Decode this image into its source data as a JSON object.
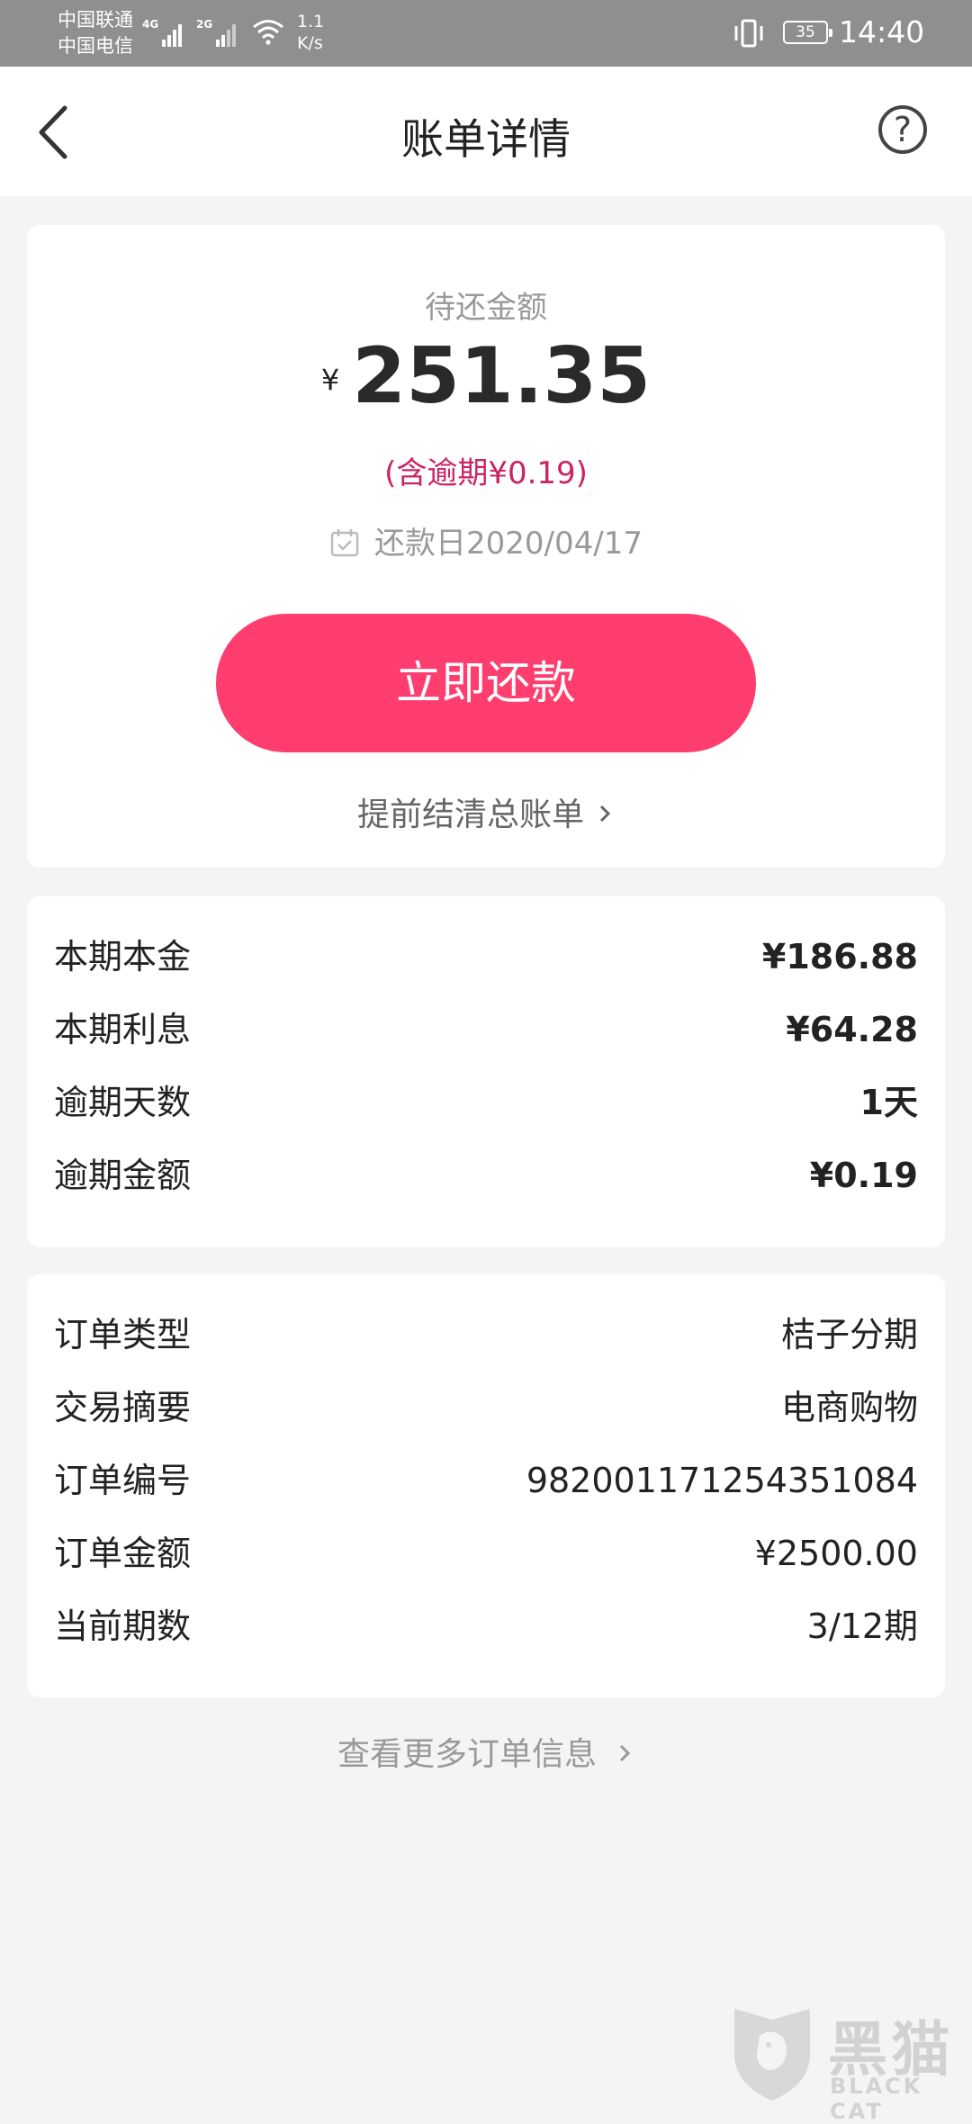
{
  "status_bar": {
    "carrier_1": "中国联通",
    "carrier_2": "中国电信",
    "network_1": "4G",
    "network_2": "2G",
    "speed_value": "1.1",
    "speed_unit": "K/s",
    "battery": "35",
    "time": "14:40"
  },
  "nav": {
    "title": "账单详情",
    "help_symbol": "?"
  },
  "summary": {
    "due_label": "待还金额",
    "currency": "¥",
    "amount": "251.35",
    "overdue_note": "(含逾期¥0.19)",
    "due_date": "还款日2020/04/17",
    "pay_button": "立即还款",
    "settle_link": "提前结清总账单"
  },
  "breakdown": [
    {
      "label": "本期本金",
      "value": "¥186.88"
    },
    {
      "label": "本期利息",
      "value": "¥64.28"
    },
    {
      "label": "逾期天数",
      "value": "1天"
    },
    {
      "label": "逾期金额",
      "value": "¥0.19"
    }
  ],
  "order": [
    {
      "label": "订单类型",
      "value": "桔子分期"
    },
    {
      "label": "交易摘要",
      "value": "电商购物"
    },
    {
      "label": "订单编号",
      "value": "982001171254351084"
    },
    {
      "label": "订单金额",
      "value": "¥2500.00"
    },
    {
      "label": "当前期数",
      "value": "3/12期"
    }
  ],
  "more_link": "查看更多订单信息",
  "watermark": {
    "text_cn": "黑猫",
    "text_en": "BLACK CAT"
  },
  "colors": {
    "accent": "#ff3d6e",
    "overdue": "#cc2266",
    "status_bar": "#8f8f8f"
  }
}
